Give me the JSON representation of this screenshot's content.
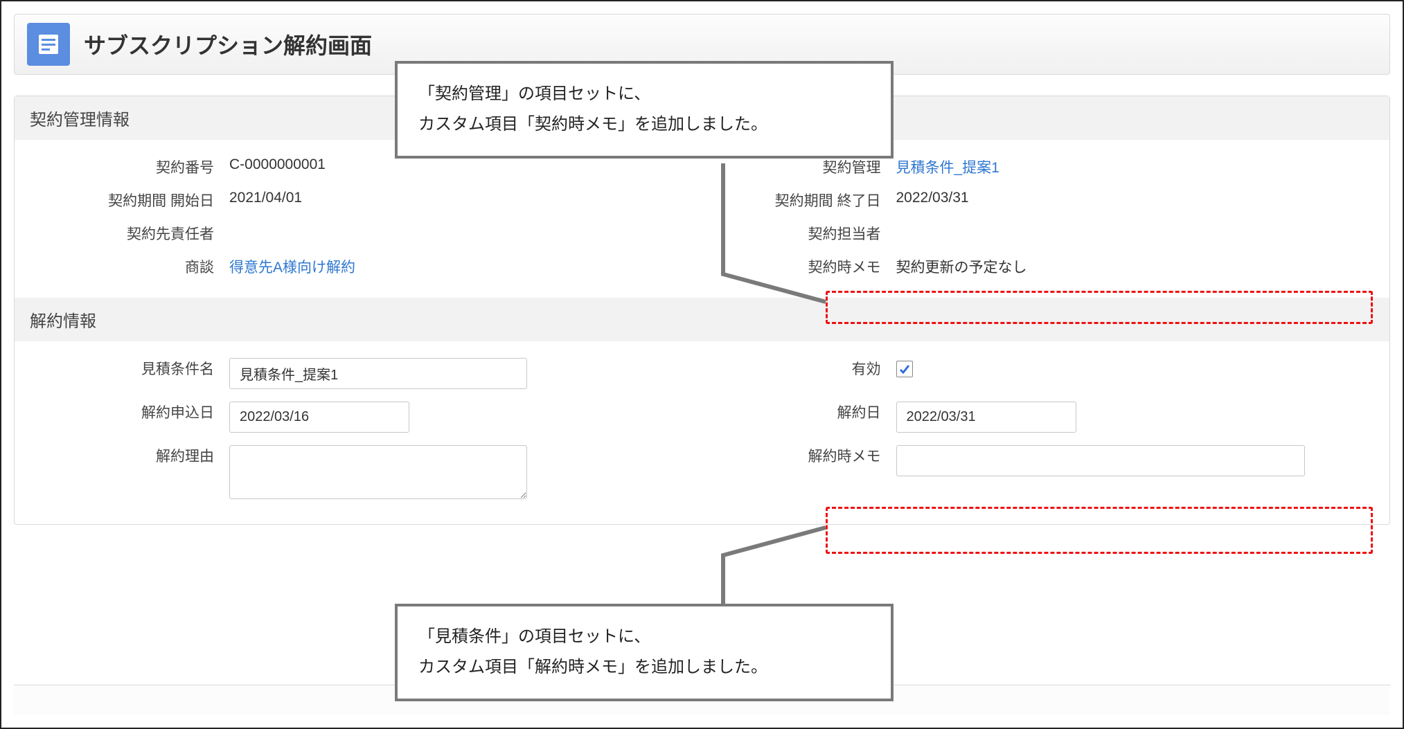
{
  "page_title": "サブスクリプション解約画面",
  "sections": {
    "contract_mgmt": {
      "header": "契約管理情報",
      "fields": {
        "contract_no_label": "契約番号",
        "contract_no_value": "C-0000000001",
        "contract_mgmt_label": "契約管理",
        "contract_mgmt_value": "見積条件_提案1",
        "period_start_label": "契約期間 開始日",
        "period_start_value": "2021/04/01",
        "period_end_label": "契約期間 終了日",
        "period_end_value": "2022/03/31",
        "client_mgr_label": "契約先責任者",
        "client_mgr_value": "",
        "contract_mgr_label": "契約担当者",
        "contract_mgr_value": "",
        "opportunity_label": "商談",
        "opportunity_value": "得意先A様向け解約",
        "contract_memo_label": "契約時メモ",
        "contract_memo_value": "契約更新の予定なし"
      }
    },
    "cancel_info": {
      "header": "解約情報",
      "fields": {
        "quote_name_label": "見積条件名",
        "quote_name_value": "見積条件_提案1",
        "active_label": "有効",
        "active_checked": true,
        "cancel_apply_date_label": "解約申込日",
        "cancel_apply_date_value": "2022/03/16",
        "cancel_date_label": "解約日",
        "cancel_date_value": "2022/03/31",
        "cancel_reason_label": "解約理由",
        "cancel_reason_value": "",
        "cancel_memo_label": "解約時メモ",
        "cancel_memo_value": ""
      }
    }
  },
  "callouts": {
    "top": {
      "line1": "「契約管理」の項目セットに、",
      "line2": "カスタム項目「契約時メモ」を追加しました。"
    },
    "bottom": {
      "line1": "「見積条件」の項目セットに、",
      "line2": "カスタム項目「解約時メモ」を追加しました。"
    }
  }
}
